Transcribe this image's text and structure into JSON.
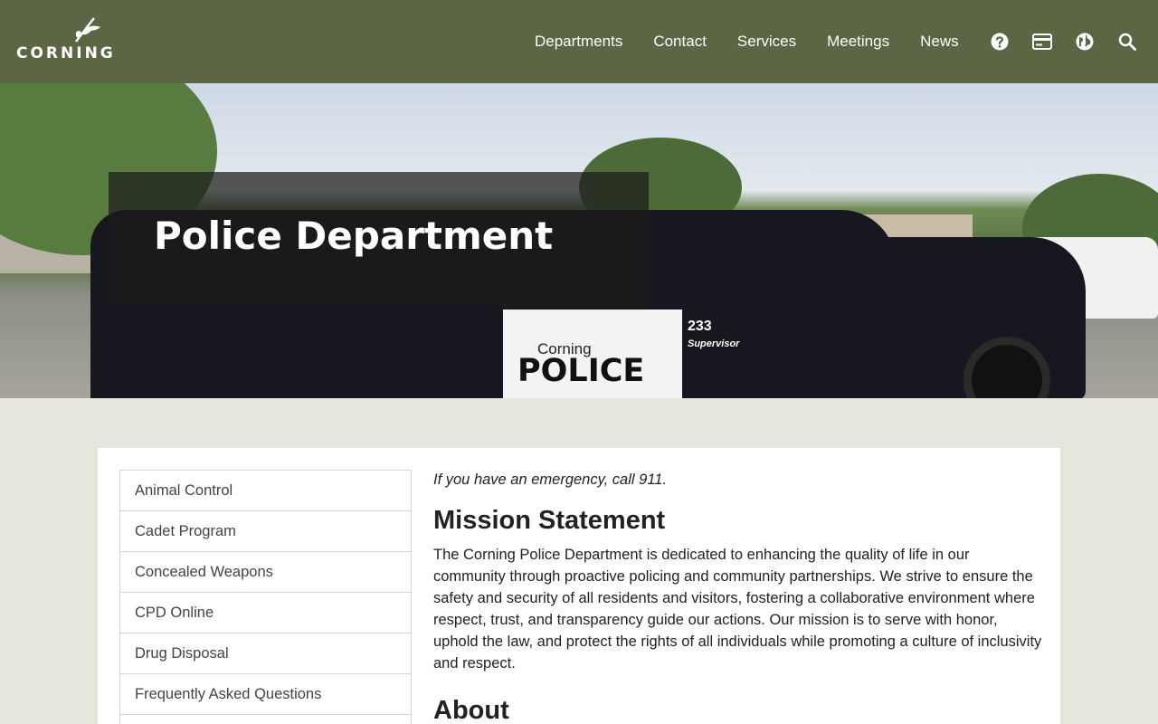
{
  "header": {
    "logo_text": "CORNING",
    "nav": [
      "Departments",
      "Contact",
      "Services",
      "Meetings",
      "News"
    ],
    "icons": [
      "help-icon",
      "payment-card-icon",
      "globe-icon",
      "search-icon"
    ],
    "bg_color": "#5c6544"
  },
  "hero": {
    "title": "Police Department",
    "door_line1": "Corning",
    "door_line2": "POLICE",
    "car_number": "233",
    "car_role": "Supervisor"
  },
  "sidebar": {
    "items": [
      "Animal Control",
      "Cadet Program",
      "Concealed Weapons",
      "CPD Online",
      "Drug Disposal",
      "Frequently Asked Questions"
    ]
  },
  "main": {
    "emergency": "If you have an emergency, call 911.",
    "mission_heading": "Mission Statement",
    "mission_body": "The Corning Police Department is dedicated to enhancing the quality of life in our community through proactive policing and community partnerships. We strive to ensure the safety and security of all residents and visitors, fostering a collaborative environment where respect, trust, and transparency guide our actions. Our mission is to serve with honor, uphold the law, and protect the rights of all individuals while promoting a culture of inclusivity and respect.",
    "about_heading": "About"
  }
}
